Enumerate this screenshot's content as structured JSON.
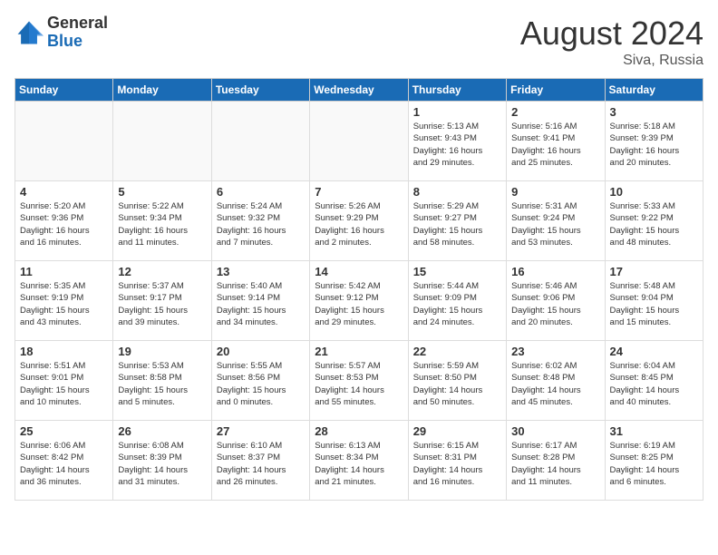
{
  "header": {
    "logo_general": "General",
    "logo_blue": "Blue",
    "month_year": "August 2024",
    "location": "Siva, Russia"
  },
  "weekdays": [
    "Sunday",
    "Monday",
    "Tuesday",
    "Wednesday",
    "Thursday",
    "Friday",
    "Saturday"
  ],
  "weeks": [
    [
      {
        "day": "",
        "info": ""
      },
      {
        "day": "",
        "info": ""
      },
      {
        "day": "",
        "info": ""
      },
      {
        "day": "",
        "info": ""
      },
      {
        "day": "1",
        "info": "Sunrise: 5:13 AM\nSunset: 9:43 PM\nDaylight: 16 hours\nand 29 minutes."
      },
      {
        "day": "2",
        "info": "Sunrise: 5:16 AM\nSunset: 9:41 PM\nDaylight: 16 hours\nand 25 minutes."
      },
      {
        "day": "3",
        "info": "Sunrise: 5:18 AM\nSunset: 9:39 PM\nDaylight: 16 hours\nand 20 minutes."
      }
    ],
    [
      {
        "day": "4",
        "info": "Sunrise: 5:20 AM\nSunset: 9:36 PM\nDaylight: 16 hours\nand 16 minutes."
      },
      {
        "day": "5",
        "info": "Sunrise: 5:22 AM\nSunset: 9:34 PM\nDaylight: 16 hours\nand 11 minutes."
      },
      {
        "day": "6",
        "info": "Sunrise: 5:24 AM\nSunset: 9:32 PM\nDaylight: 16 hours\nand 7 minutes."
      },
      {
        "day": "7",
        "info": "Sunrise: 5:26 AM\nSunset: 9:29 PM\nDaylight: 16 hours\nand 2 minutes."
      },
      {
        "day": "8",
        "info": "Sunrise: 5:29 AM\nSunset: 9:27 PM\nDaylight: 15 hours\nand 58 minutes."
      },
      {
        "day": "9",
        "info": "Sunrise: 5:31 AM\nSunset: 9:24 PM\nDaylight: 15 hours\nand 53 minutes."
      },
      {
        "day": "10",
        "info": "Sunrise: 5:33 AM\nSunset: 9:22 PM\nDaylight: 15 hours\nand 48 minutes."
      }
    ],
    [
      {
        "day": "11",
        "info": "Sunrise: 5:35 AM\nSunset: 9:19 PM\nDaylight: 15 hours\nand 43 minutes."
      },
      {
        "day": "12",
        "info": "Sunrise: 5:37 AM\nSunset: 9:17 PM\nDaylight: 15 hours\nand 39 minutes."
      },
      {
        "day": "13",
        "info": "Sunrise: 5:40 AM\nSunset: 9:14 PM\nDaylight: 15 hours\nand 34 minutes."
      },
      {
        "day": "14",
        "info": "Sunrise: 5:42 AM\nSunset: 9:12 PM\nDaylight: 15 hours\nand 29 minutes."
      },
      {
        "day": "15",
        "info": "Sunrise: 5:44 AM\nSunset: 9:09 PM\nDaylight: 15 hours\nand 24 minutes."
      },
      {
        "day": "16",
        "info": "Sunrise: 5:46 AM\nSunset: 9:06 PM\nDaylight: 15 hours\nand 20 minutes."
      },
      {
        "day": "17",
        "info": "Sunrise: 5:48 AM\nSunset: 9:04 PM\nDaylight: 15 hours\nand 15 minutes."
      }
    ],
    [
      {
        "day": "18",
        "info": "Sunrise: 5:51 AM\nSunset: 9:01 PM\nDaylight: 15 hours\nand 10 minutes."
      },
      {
        "day": "19",
        "info": "Sunrise: 5:53 AM\nSunset: 8:58 PM\nDaylight: 15 hours\nand 5 minutes."
      },
      {
        "day": "20",
        "info": "Sunrise: 5:55 AM\nSunset: 8:56 PM\nDaylight: 15 hours\nand 0 minutes."
      },
      {
        "day": "21",
        "info": "Sunrise: 5:57 AM\nSunset: 8:53 PM\nDaylight: 14 hours\nand 55 minutes."
      },
      {
        "day": "22",
        "info": "Sunrise: 5:59 AM\nSunset: 8:50 PM\nDaylight: 14 hours\nand 50 minutes."
      },
      {
        "day": "23",
        "info": "Sunrise: 6:02 AM\nSunset: 8:48 PM\nDaylight: 14 hours\nand 45 minutes."
      },
      {
        "day": "24",
        "info": "Sunrise: 6:04 AM\nSunset: 8:45 PM\nDaylight: 14 hours\nand 40 minutes."
      }
    ],
    [
      {
        "day": "25",
        "info": "Sunrise: 6:06 AM\nSunset: 8:42 PM\nDaylight: 14 hours\nand 36 minutes."
      },
      {
        "day": "26",
        "info": "Sunrise: 6:08 AM\nSunset: 8:39 PM\nDaylight: 14 hours\nand 31 minutes."
      },
      {
        "day": "27",
        "info": "Sunrise: 6:10 AM\nSunset: 8:37 PM\nDaylight: 14 hours\nand 26 minutes."
      },
      {
        "day": "28",
        "info": "Sunrise: 6:13 AM\nSunset: 8:34 PM\nDaylight: 14 hours\nand 21 minutes."
      },
      {
        "day": "29",
        "info": "Sunrise: 6:15 AM\nSunset: 8:31 PM\nDaylight: 14 hours\nand 16 minutes."
      },
      {
        "day": "30",
        "info": "Sunrise: 6:17 AM\nSunset: 8:28 PM\nDaylight: 14 hours\nand 11 minutes."
      },
      {
        "day": "31",
        "info": "Sunrise: 6:19 AM\nSunset: 8:25 PM\nDaylight: 14 hours\nand 6 minutes."
      }
    ]
  ]
}
